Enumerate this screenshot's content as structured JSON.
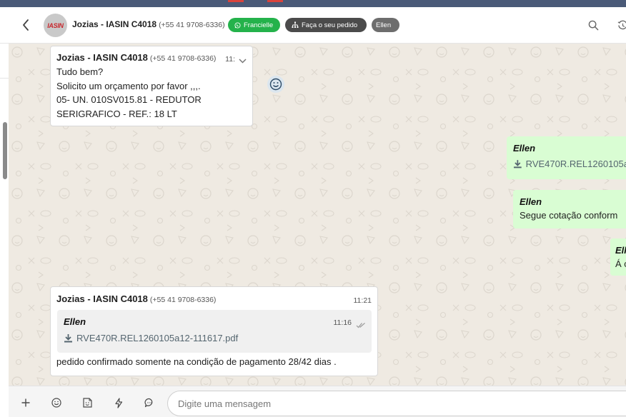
{
  "header": {
    "contact_name": "Jozias - IASIN C4018",
    "phone": "(+55 41 9708-6336)",
    "avatar_logo": "IASIN",
    "tags": [
      {
        "label": "Francielle",
        "icon": "whatsapp-icon",
        "color": "#24b24b"
      },
      {
        "label": "Faça o seu pedido",
        "icon": "sitemap-icon",
        "color": "#4b4b4b"
      },
      {
        "label": "Ellen",
        "color": "#6d6d6d"
      }
    ],
    "icons": [
      "back-icon",
      "search-icon",
      "history-icon"
    ]
  },
  "messages": {
    "first": {
      "sender": "Jozias - IASIN C4018",
      "phone": "(+55 41 9708-6336)",
      "time": "11:",
      "lines": [
        "Tudo bem?",
        "Solicito um orçamento por favor ,,,.",
        "05- UN. 010SV015.81 - REDUTOR",
        "SERIGRAFICO - REF.: 18 LT"
      ]
    },
    "out1": {
      "sender": "Ellen",
      "file": "RVE470R.REL1260105a"
    },
    "out2": {
      "sender": "Ellen",
      "text": "Segue cotação conform"
    },
    "out3": {
      "sender": "Ell",
      "text": "Á c"
    },
    "reply": {
      "sender": "Jozias - IASIN C4018",
      "phone": "(+55 41 9708-6336)",
      "time": "11:21",
      "quoted": {
        "sender": "Ellen",
        "time": "11:16",
        "file": "RVE470R.REL1260105a12-111617.pdf"
      },
      "caption": "pedido confirmado somente na condição de pagamento 28/42 dias ."
    }
  },
  "composer": {
    "placeholder": "Digite uma mensagem",
    "icons": [
      "plus-icon",
      "emoji-icon",
      "sticker-icon",
      "bolt-icon",
      "quick-reply-icon"
    ]
  },
  "colors": {
    "accent_green": "#24b24b",
    "outgoing_bubble": "#d9fdd3",
    "chat_background": "#efeae2",
    "top_strip": "#4a5a78"
  }
}
